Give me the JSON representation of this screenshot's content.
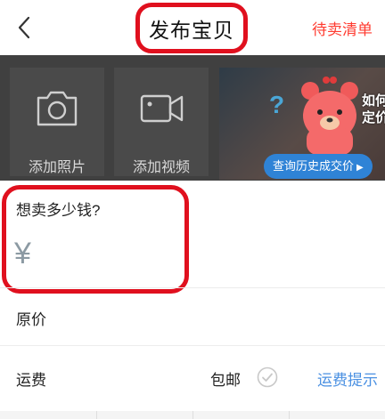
{
  "header": {
    "title": "发布宝贝",
    "right_link": "待卖清单",
    "back_icon": "chevron-left-icon"
  },
  "media": {
    "photo_label": "添加照片",
    "video_label": "添加视频",
    "photo_icon": "camera-icon",
    "video_icon": "video-camera-icon",
    "banner": {
      "question": "如何\n定价?",
      "button_label": "查询历史成交价"
    }
  },
  "price": {
    "question": "想卖多少钱?",
    "currency_symbol": "¥"
  },
  "original_price": {
    "label": "原价"
  },
  "shipping": {
    "label": "运费",
    "value": "包邮",
    "tip_link": "运费提示",
    "check_icon": "check-circle-icon"
  },
  "colors": {
    "accent_red": "#ff3b30",
    "highlight_red": "#e0101e",
    "link_blue": "#4a90e2",
    "banner_button": "#2f83d6",
    "overlay_gray": "#404040"
  }
}
